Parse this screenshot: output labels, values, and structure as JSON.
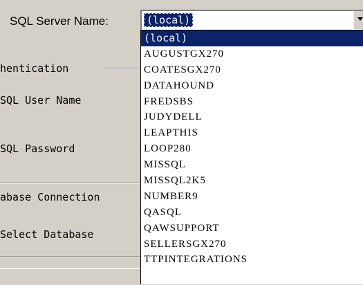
{
  "form": {
    "server_label": "SQL Server Name:",
    "server_value": "(local)",
    "auth_group_label": "hentication",
    "user_label": "SQL User Name",
    "password_label": "SQL Password",
    "db_group_label": "abase Connection",
    "select_db_label": "Select Database"
  },
  "dropdown": {
    "selected": "(local)",
    "items": [
      "(local)",
      "AUGUSTGX270",
      "COATESGX270",
      "DATAHOUND",
      "FREDSBS",
      "JUDYDELL",
      "LEAPTHIS",
      "LOOP280",
      "MISSQL",
      "MISSQL2K5",
      "NUMBER9",
      "QASQL",
      "QAWSUPPORT",
      "SELLERSGX270",
      "TTPINTEGRATIONS"
    ]
  },
  "icons": {
    "combo_arrow": "chevron-down-icon"
  },
  "colors": {
    "selection": "#0a246a",
    "dialog_bg": "#d4d0c8"
  }
}
